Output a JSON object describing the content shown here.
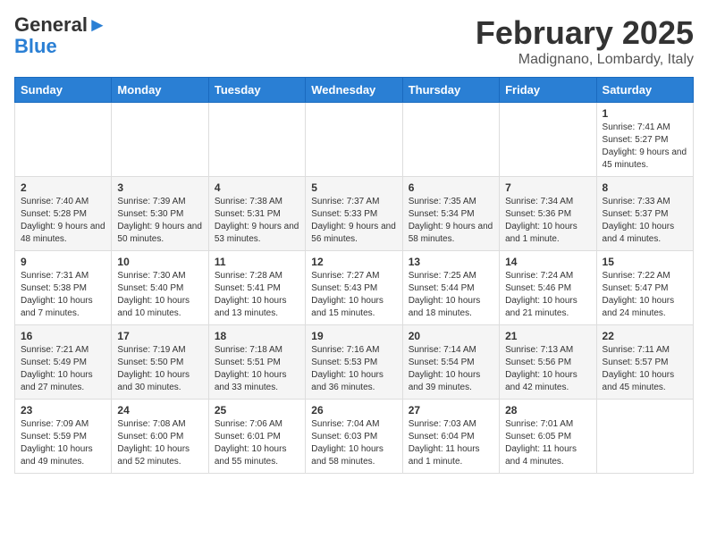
{
  "logo": {
    "line1": "General",
    "line2": "Blue"
  },
  "header": {
    "month": "February 2025",
    "location": "Madignano, Lombardy, Italy"
  },
  "weekdays": [
    "Sunday",
    "Monday",
    "Tuesday",
    "Wednesday",
    "Thursday",
    "Friday",
    "Saturday"
  ],
  "weeks": [
    [
      {
        "day": "",
        "info": ""
      },
      {
        "day": "",
        "info": ""
      },
      {
        "day": "",
        "info": ""
      },
      {
        "day": "",
        "info": ""
      },
      {
        "day": "",
        "info": ""
      },
      {
        "day": "",
        "info": ""
      },
      {
        "day": "1",
        "info": "Sunrise: 7:41 AM\nSunset: 5:27 PM\nDaylight: 9 hours and 45 minutes."
      }
    ],
    [
      {
        "day": "2",
        "info": "Sunrise: 7:40 AM\nSunset: 5:28 PM\nDaylight: 9 hours and 48 minutes."
      },
      {
        "day": "3",
        "info": "Sunrise: 7:39 AM\nSunset: 5:30 PM\nDaylight: 9 hours and 50 minutes."
      },
      {
        "day": "4",
        "info": "Sunrise: 7:38 AM\nSunset: 5:31 PM\nDaylight: 9 hours and 53 minutes."
      },
      {
        "day": "5",
        "info": "Sunrise: 7:37 AM\nSunset: 5:33 PM\nDaylight: 9 hours and 56 minutes."
      },
      {
        "day": "6",
        "info": "Sunrise: 7:35 AM\nSunset: 5:34 PM\nDaylight: 9 hours and 58 minutes."
      },
      {
        "day": "7",
        "info": "Sunrise: 7:34 AM\nSunset: 5:36 PM\nDaylight: 10 hours and 1 minute."
      },
      {
        "day": "8",
        "info": "Sunrise: 7:33 AM\nSunset: 5:37 PM\nDaylight: 10 hours and 4 minutes."
      }
    ],
    [
      {
        "day": "9",
        "info": "Sunrise: 7:31 AM\nSunset: 5:38 PM\nDaylight: 10 hours and 7 minutes."
      },
      {
        "day": "10",
        "info": "Sunrise: 7:30 AM\nSunset: 5:40 PM\nDaylight: 10 hours and 10 minutes."
      },
      {
        "day": "11",
        "info": "Sunrise: 7:28 AM\nSunset: 5:41 PM\nDaylight: 10 hours and 13 minutes."
      },
      {
        "day": "12",
        "info": "Sunrise: 7:27 AM\nSunset: 5:43 PM\nDaylight: 10 hours and 15 minutes."
      },
      {
        "day": "13",
        "info": "Sunrise: 7:25 AM\nSunset: 5:44 PM\nDaylight: 10 hours and 18 minutes."
      },
      {
        "day": "14",
        "info": "Sunrise: 7:24 AM\nSunset: 5:46 PM\nDaylight: 10 hours and 21 minutes."
      },
      {
        "day": "15",
        "info": "Sunrise: 7:22 AM\nSunset: 5:47 PM\nDaylight: 10 hours and 24 minutes."
      }
    ],
    [
      {
        "day": "16",
        "info": "Sunrise: 7:21 AM\nSunset: 5:49 PM\nDaylight: 10 hours and 27 minutes."
      },
      {
        "day": "17",
        "info": "Sunrise: 7:19 AM\nSunset: 5:50 PM\nDaylight: 10 hours and 30 minutes."
      },
      {
        "day": "18",
        "info": "Sunrise: 7:18 AM\nSunset: 5:51 PM\nDaylight: 10 hours and 33 minutes."
      },
      {
        "day": "19",
        "info": "Sunrise: 7:16 AM\nSunset: 5:53 PM\nDaylight: 10 hours and 36 minutes."
      },
      {
        "day": "20",
        "info": "Sunrise: 7:14 AM\nSunset: 5:54 PM\nDaylight: 10 hours and 39 minutes."
      },
      {
        "day": "21",
        "info": "Sunrise: 7:13 AM\nSunset: 5:56 PM\nDaylight: 10 hours and 42 minutes."
      },
      {
        "day": "22",
        "info": "Sunrise: 7:11 AM\nSunset: 5:57 PM\nDaylight: 10 hours and 45 minutes."
      }
    ],
    [
      {
        "day": "23",
        "info": "Sunrise: 7:09 AM\nSunset: 5:59 PM\nDaylight: 10 hours and 49 minutes."
      },
      {
        "day": "24",
        "info": "Sunrise: 7:08 AM\nSunset: 6:00 PM\nDaylight: 10 hours and 52 minutes."
      },
      {
        "day": "25",
        "info": "Sunrise: 7:06 AM\nSunset: 6:01 PM\nDaylight: 10 hours and 55 minutes."
      },
      {
        "day": "26",
        "info": "Sunrise: 7:04 AM\nSunset: 6:03 PM\nDaylight: 10 hours and 58 minutes."
      },
      {
        "day": "27",
        "info": "Sunrise: 7:03 AM\nSunset: 6:04 PM\nDaylight: 11 hours and 1 minute."
      },
      {
        "day": "28",
        "info": "Sunrise: 7:01 AM\nSunset: 6:05 PM\nDaylight: 11 hours and 4 minutes."
      },
      {
        "day": "",
        "info": ""
      }
    ]
  ]
}
